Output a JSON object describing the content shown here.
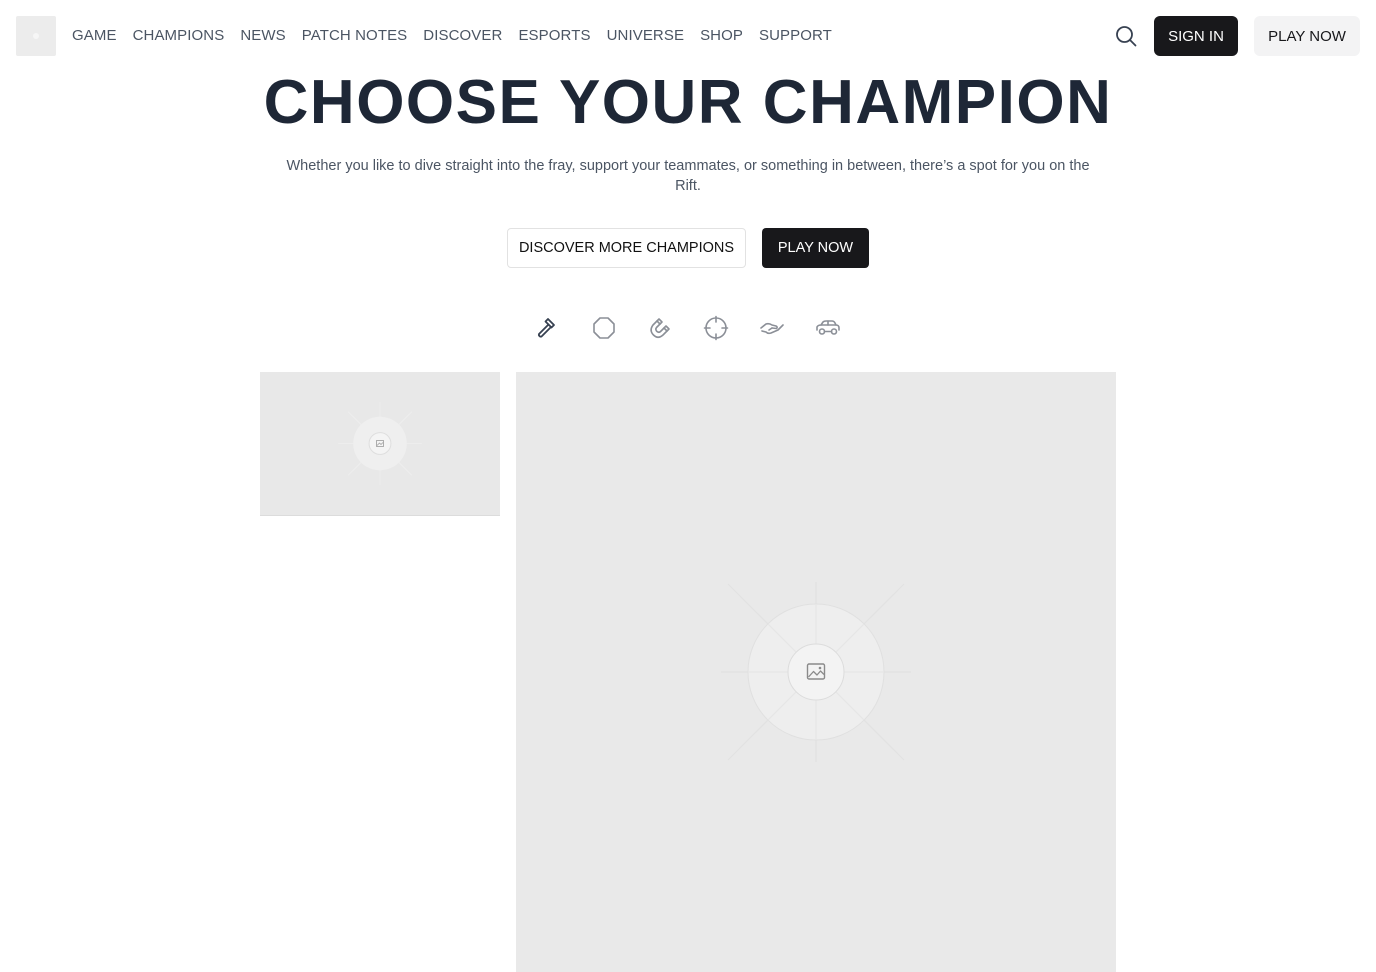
{
  "header": {
    "logo_icon": "riot-logo-icon",
    "nav": [
      "GAME",
      "CHAMPIONS",
      "NEWS",
      "PATCH NOTES",
      "DISCOVER",
      "ESPORTS",
      "UNIVERSE",
      "SHOP",
      "SUPPORT"
    ],
    "search_icon": "search-icon",
    "sign_in_label": "SIGN IN",
    "play_now_label": "PLAY NOW"
  },
  "hero": {
    "title": "CHOOSE YOUR CHAMPION",
    "subtitle": "Whether you like to dive straight into the fray, support your teammates, or something in between, there’s a spot for you on the Rift.",
    "discover_label": "DISCOVER MORE CHAMPIONS",
    "play_label": "PLAY NOW"
  },
  "roles": [
    {
      "name": "assassin",
      "icon": "hammer-icon",
      "active": true
    },
    {
      "name": "fighter",
      "icon": "octagon-icon",
      "active": false
    },
    {
      "name": "mage",
      "icon": "magnet-icon",
      "active": false
    },
    {
      "name": "marksman",
      "icon": "crosshair-icon",
      "active": false
    },
    {
      "name": "support",
      "icon": "handshake-icon",
      "active": false
    },
    {
      "name": "tank",
      "icon": "car-icon",
      "active": false
    }
  ],
  "colors": {
    "dark": "#18181b",
    "title": "#1e2736",
    "muted": "#4b5563",
    "placeholder_bg": "#e9e9e9"
  },
  "images": {
    "thumbnail": "image-placeholder-icon",
    "main": "image-placeholder-icon"
  }
}
